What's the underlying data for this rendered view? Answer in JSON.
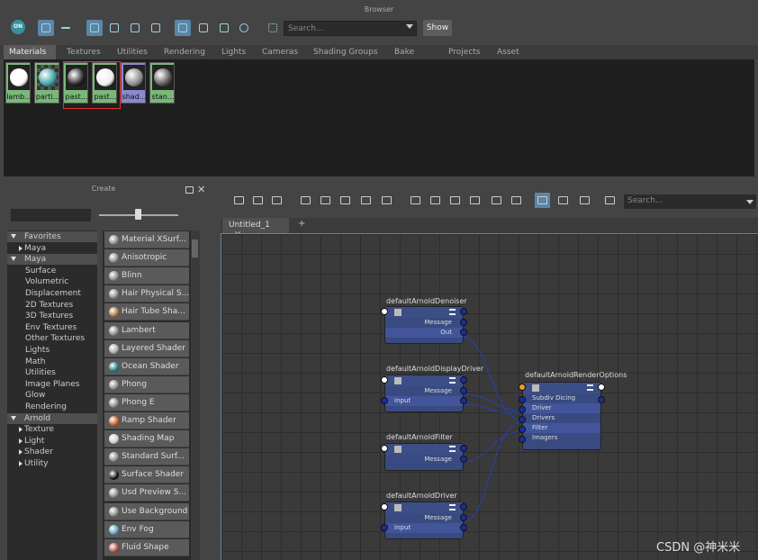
{
  "browser": {
    "title": "Browser",
    "search_placeholder": "Search...",
    "show_label": "Show",
    "tabs": [
      "Materials",
      "Textures",
      "Utilities",
      "Rendering",
      "Lights",
      "Cameras",
      "Shading Groups",
      "Bake Sets",
      "Projects",
      "Asset Nodes"
    ],
    "active_tab": "Materials",
    "toolbar_icons": [
      "on-icon",
      "grid-icon",
      "line-icon",
      "frame-icon",
      "box-icon",
      "box-icon",
      "box-icon",
      "sort-az-icon",
      "sort-type-icon",
      "sort-time-icon",
      "refresh-icon",
      "dotted-frame-icon"
    ],
    "swatches": [
      {
        "label": "lamb...",
        "color": "#ffffff"
      },
      {
        "label": "parti...",
        "color": "#3aa0a0"
      },
      {
        "label": "past...",
        "color": "#222222"
      },
      {
        "label": "past...",
        "color": "#eeeeee"
      },
      {
        "label": "shad...",
        "color": "#888888"
      },
      {
        "label": "stan...",
        "color": "#555555"
      }
    ]
  },
  "create": {
    "title": "Create",
    "tree": [
      {
        "label": "Favorites",
        "type": "hdr",
        "expanded": true
      },
      {
        "label": "Maya",
        "type": "child-collapsed"
      },
      {
        "label": "Maya",
        "type": "hdr",
        "expanded": true
      },
      {
        "label": "Surface",
        "type": "leaf"
      },
      {
        "label": "Volumetric",
        "type": "leaf"
      },
      {
        "label": "Displacement",
        "type": "leaf"
      },
      {
        "label": "2D Textures",
        "type": "leaf"
      },
      {
        "label": "3D Textures",
        "type": "leaf"
      },
      {
        "label": "Env Textures",
        "type": "leaf"
      },
      {
        "label": "Other Textures",
        "type": "leaf"
      },
      {
        "label": "Lights",
        "type": "leaf"
      },
      {
        "label": "Math",
        "type": "leaf"
      },
      {
        "label": "Utilities",
        "type": "leaf"
      },
      {
        "label": "Image Planes",
        "type": "leaf"
      },
      {
        "label": "Glow",
        "type": "leaf"
      },
      {
        "label": "Rendering",
        "type": "leaf"
      },
      {
        "label": "Arnold",
        "type": "hdr",
        "expanded": true
      },
      {
        "label": "Texture",
        "type": "child-collapsed"
      },
      {
        "label": "Light",
        "type": "child-collapsed"
      },
      {
        "label": "Shader",
        "type": "child-collapsed"
      },
      {
        "label": "Utility",
        "type": "child-collapsed"
      }
    ],
    "nodes": [
      {
        "label": "Material XSurf...",
        "color": "#888"
      },
      {
        "label": "Anisotropic",
        "color": "#888"
      },
      {
        "label": "Blinn",
        "color": "#888"
      },
      {
        "label": "Hair Physical S...",
        "color": "#888"
      },
      {
        "label": "Hair Tube Sha...",
        "color": "#b07a40"
      },
      {
        "label": "Lambert",
        "color": "#888"
      },
      {
        "label": "Layered Shader",
        "color": "#aaa"
      },
      {
        "label": "Ocean Shader",
        "color": "#208080"
      },
      {
        "label": "Phong",
        "color": "#888"
      },
      {
        "label": "Phong E",
        "color": "#888"
      },
      {
        "label": "Ramp Shader",
        "color": "#d06020"
      },
      {
        "label": "Shading Map",
        "color": "#ccc"
      },
      {
        "label": "Standard Surf...",
        "color": "#888"
      },
      {
        "label": "Surface Shader",
        "color": "#111"
      },
      {
        "label": "Usd Preview S...",
        "color": "#888"
      },
      {
        "label": "Use Background",
        "color": "#888"
      },
      {
        "label": "Env Fog",
        "color": "#5aa0c0"
      },
      {
        "label": "Fluid Shape",
        "color": "#b05040"
      }
    ]
  },
  "editor": {
    "search_placeholder": "Search...",
    "tab_label": "Untitled_1",
    "tab_close": "×",
    "tab_plus": "+",
    "nodes": [
      {
        "id": "denoiser",
        "title": "defaultArnoldDenoiser",
        "rows": [
          "Message",
          "Out"
        ]
      },
      {
        "id": "displaydriver",
        "title": "defaultArnoldDisplayDriver",
        "rows": [
          "Message",
          "Input"
        ]
      },
      {
        "id": "filter",
        "title": "defaultArnoldFilter",
        "rows": [
          "Message"
        ]
      },
      {
        "id": "driver",
        "title": "defaultArnoldDriver",
        "rows": [
          "Message",
          "Input"
        ]
      },
      {
        "id": "options",
        "title": "defaultArnoldRenderOptions",
        "rows": [
          "Subdiv Dicing Camera",
          "Driver",
          "Drivers",
          "Filter",
          "Imagers"
        ]
      }
    ]
  },
  "watermark": "CSDN @神米米"
}
